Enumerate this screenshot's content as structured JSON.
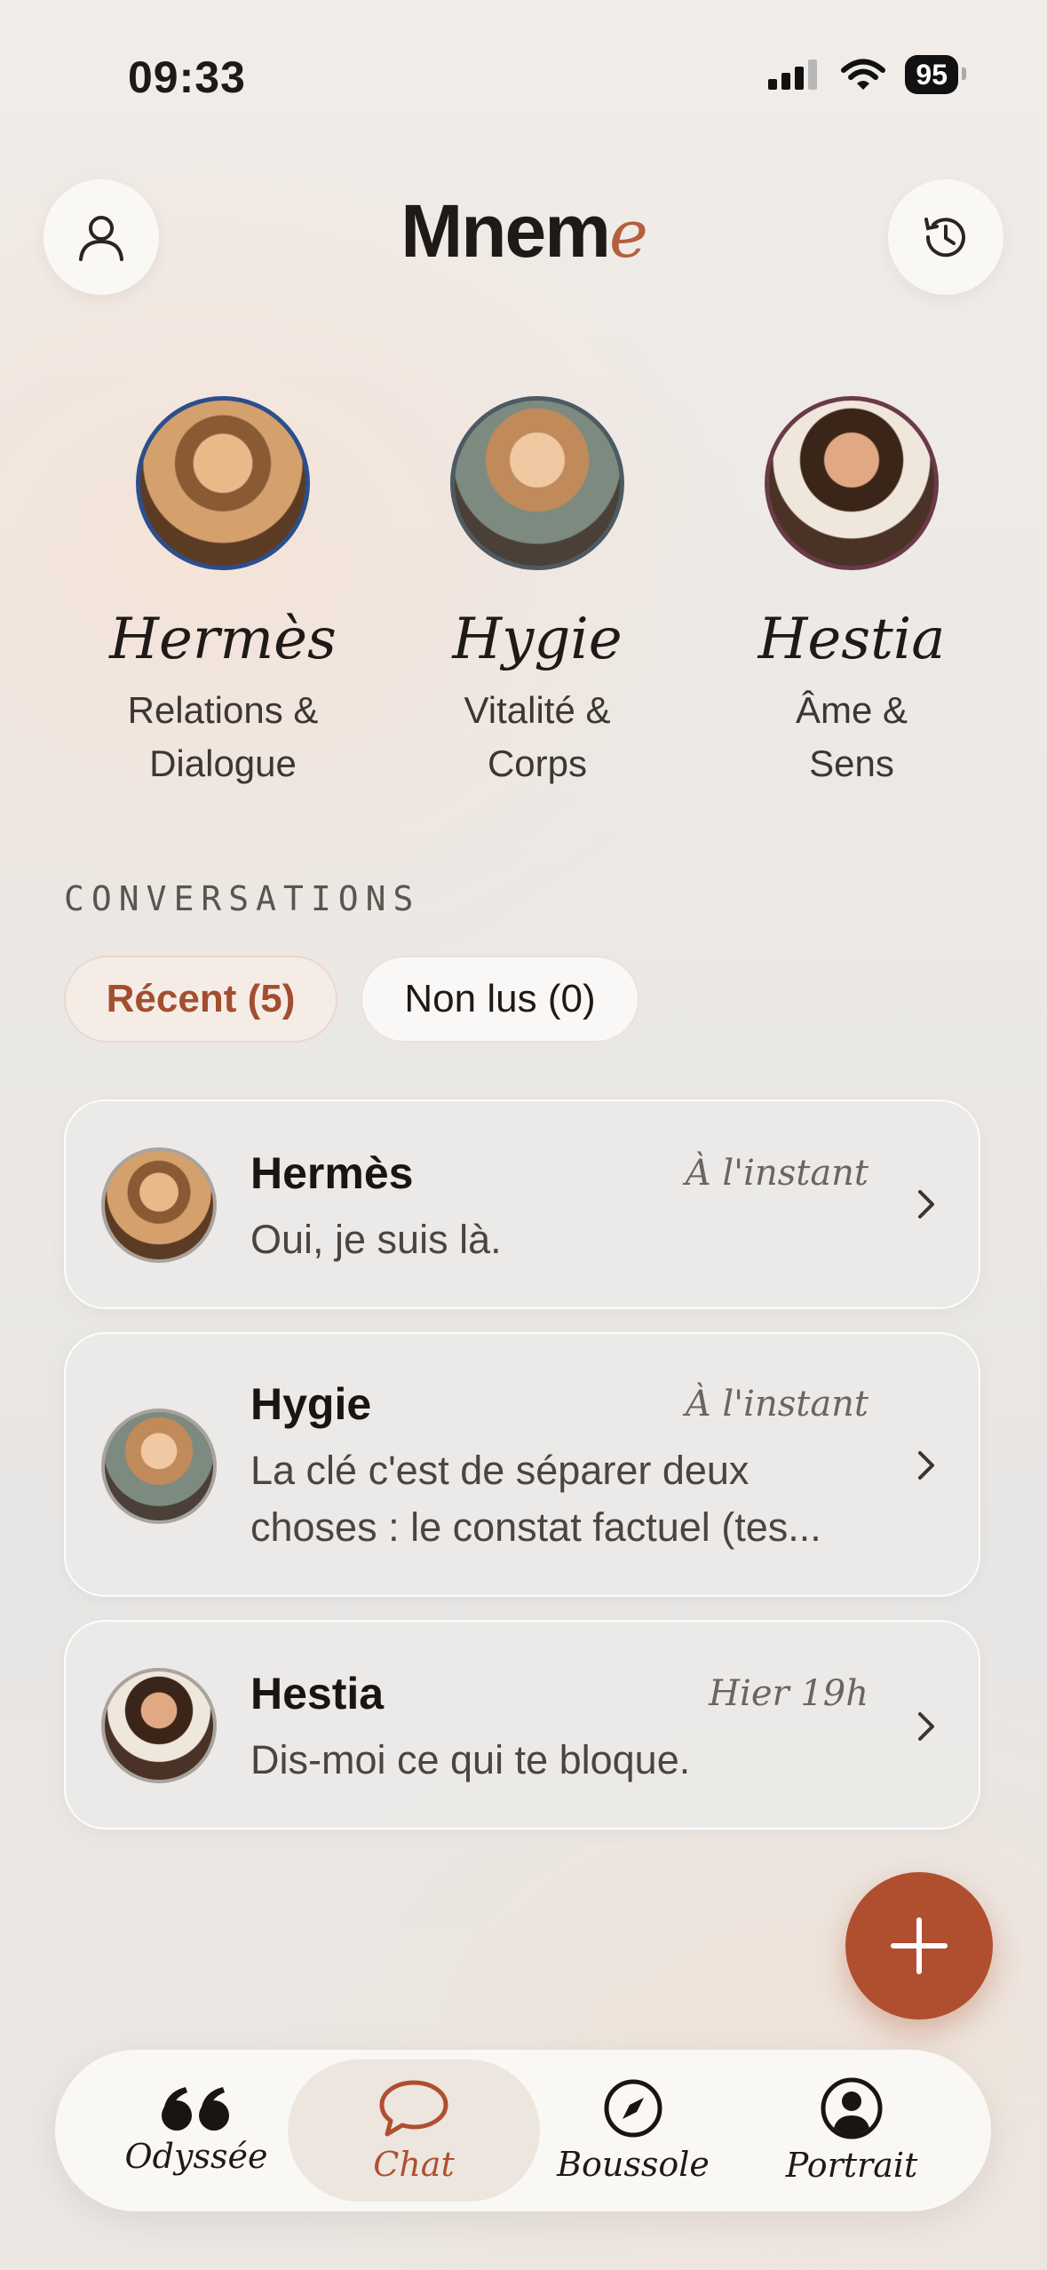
{
  "status_bar": {
    "time": "09:33",
    "battery": "95"
  },
  "header": {
    "title_main": "Mnem",
    "title_accent": "e",
    "profile_icon": "user-icon",
    "history_icon": "history-icon"
  },
  "personas": [
    {
      "name": "Hermès",
      "desc_line1": "Relations &",
      "desc_line2": "Dialogue",
      "ring": "#2c4f8c"
    },
    {
      "name": "Hygie",
      "desc_line1": "Vitalité &",
      "desc_line2": "Corps",
      "ring": "#4d5a63"
    },
    {
      "name": "Hestia",
      "desc_line1": "Âme &",
      "desc_line2": "Sens",
      "ring": "#6a3a48"
    }
  ],
  "conversations": {
    "title": "CONVERSATIONS",
    "filters": {
      "recent": "Récent (5)",
      "unread": "Non lus (0)"
    },
    "items": [
      {
        "name": "Hermès",
        "time": "À l'instant",
        "line1": "Oui, je suis là.",
        "line2": ""
      },
      {
        "name": "Hygie",
        "time": "À l'instant",
        "line1": "La clé c'est de séparer deux",
        "line2": "choses : le constat factuel (tes..."
      },
      {
        "name": "Hestia",
        "time": "Hier 19h",
        "line1": "Dis-moi ce qui te bloque.",
        "line2": ""
      }
    ]
  },
  "fab": {
    "icon": "plus-icon"
  },
  "tabs": [
    {
      "label": "Odyssée",
      "icon": "quote-icon"
    },
    {
      "label": "Chat",
      "icon": "chat-bubble-icon"
    },
    {
      "label": "Boussole",
      "icon": "compass-icon"
    },
    {
      "label": "Portrait",
      "icon": "user-circle-icon"
    }
  ],
  "colors": {
    "accent": "#b04f30",
    "text": "#1f1a17"
  }
}
